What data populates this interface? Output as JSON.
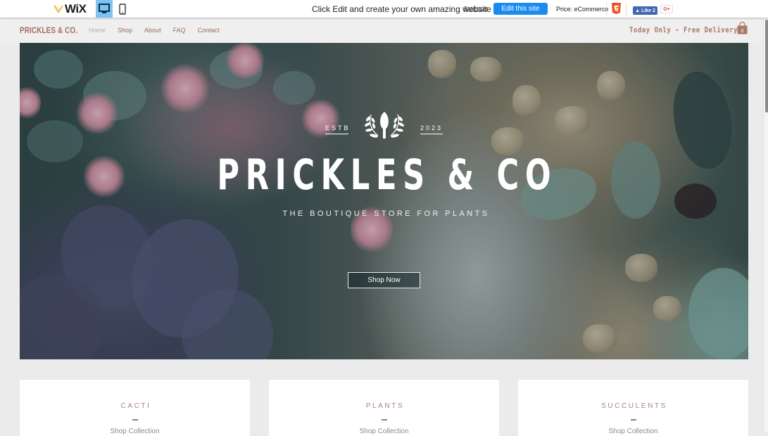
{
  "wix_bar": {
    "logo_text": "WiX",
    "device_desktop_icon": "desktop-icon",
    "device_mobile_icon": "mobile-icon",
    "promo_text": "Click Edit and create your own amazing website",
    "read_more": "Read more",
    "edit_button": "Edit this site",
    "price_text": "Price: eCommerce",
    "html5_icon": "html5-icon",
    "like_button": "Like 2",
    "gplus_button": "G+"
  },
  "site_header": {
    "brand": "PRICKLES & CO.",
    "nav": [
      {
        "label": "Home",
        "active": true
      },
      {
        "label": "Shop",
        "active": false
      },
      {
        "label": "About",
        "active": false
      },
      {
        "label": "FAQ",
        "active": false
      },
      {
        "label": "Contact",
        "active": false
      }
    ],
    "promo": "Today Only - Free Delivery",
    "cart_count": "0"
  },
  "hero": {
    "estb_label": "ESTB",
    "year": "2023",
    "title": "PRICKLES & CO",
    "subtitle": "THE BOUTIQUE STORE FOR PLANTS",
    "cta": "Shop Now"
  },
  "collections": [
    {
      "title": "CACTI",
      "link": "Shop Collection"
    },
    {
      "title": "PLANTS",
      "link": "Shop Collection"
    },
    {
      "title": "SUCCULENTS",
      "link": "Shop Collection"
    }
  ],
  "colors": {
    "brand": "#a26d5b",
    "edit_button": "#1a8cf0",
    "facebook": "#4267b2",
    "page_bg": "#ebebeb"
  }
}
